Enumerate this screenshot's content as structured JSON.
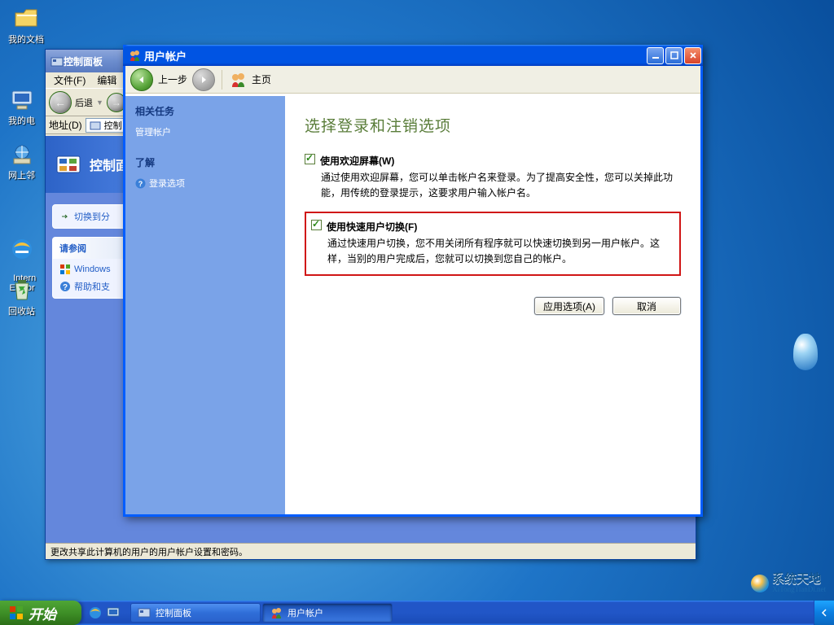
{
  "desktop": {
    "icons": [
      {
        "label": "我的文档"
      },
      {
        "label": "我的电"
      },
      {
        "label": "网上邻"
      },
      {
        "label": "Intern\nExplor"
      },
      {
        "label": "回收站"
      }
    ]
  },
  "control_panel": {
    "title": "控制面板",
    "menu": {
      "file": "文件(F)",
      "edit": "编辑"
    },
    "nav": {
      "back": "后退",
      "addr_label": "地址(D)",
      "addr_value": "控制"
    },
    "head_band": "控制面板",
    "side1": {
      "link": "切换到分"
    },
    "side2": {
      "head": "请参阅",
      "link1": "Windows",
      "link2": "帮助和支"
    },
    "status": "更改共享此计算机的用户的用户帐户设置和密码。"
  },
  "user_accounts": {
    "title": "用户帐户",
    "toolbar": {
      "back": "上一步",
      "home": "主页"
    },
    "sidebar": {
      "related_head": "相关任务",
      "related_link": "管理帐户",
      "learn_head": "了解",
      "learn_link": "登录选项"
    },
    "heading": "选择登录和注销选项",
    "option1": {
      "checked": true,
      "title": "使用欢迎屏幕(W)",
      "desc": "通过使用欢迎屏幕，您可以单击帐户名来登录。为了提高安全性，您可以关掉此功能，用传统的登录提示，这要求用户输入帐户名。"
    },
    "option2": {
      "checked": true,
      "title": "使用快速用户切换(F)",
      "desc": "通过快速用户切换，您不用关闭所有程序就可以快速切换到另一用户帐户。这样，当别的用户完成后，您就可以切换到您自己的帐户。"
    },
    "buttons": {
      "apply": "应用选项(A)",
      "cancel": "取消"
    }
  },
  "taskbar": {
    "start": "开始",
    "items": [
      {
        "label": "控制面板",
        "active": false
      },
      {
        "label": "用户帐户",
        "active": true
      }
    ]
  },
  "watermark": {
    "main": "系统天地",
    "sub": "XiTongTianDi.net"
  }
}
